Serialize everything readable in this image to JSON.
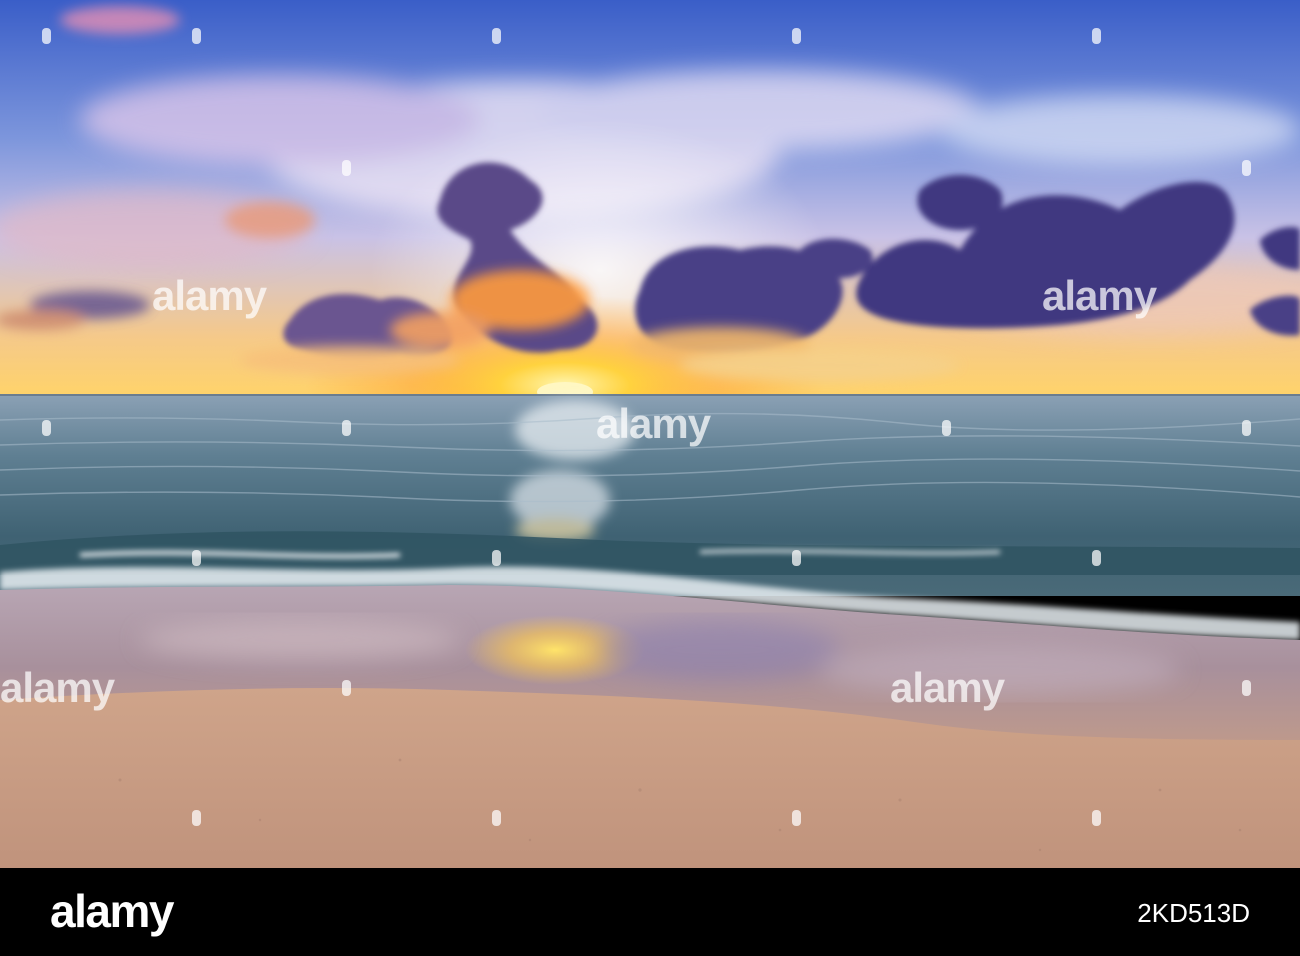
{
  "photo": {
    "subject": "sunset-over-sea-beach",
    "colors": {
      "sky_top": "#3f63c9",
      "sky_mid": "#9fb3e6",
      "sun": "#ffd23a",
      "cloud_dark": "#4a3f86",
      "sea": "#5f7f92",
      "sand": "#c79f86"
    }
  },
  "watermark": {
    "text": "alamy"
  },
  "footer": {
    "logo": "alamy",
    "image_id": "2KD513D"
  }
}
